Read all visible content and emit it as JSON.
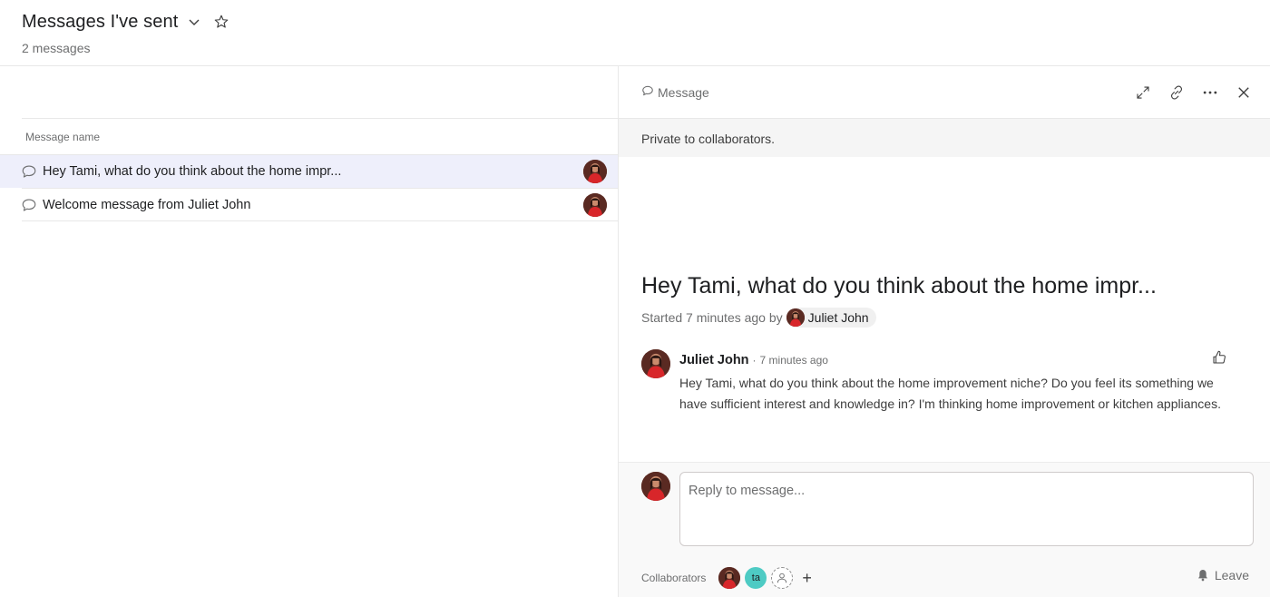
{
  "header": {
    "title": "Messages I've sent",
    "subtitle": "2 messages",
    "chevron_icon": "chevron-down-icon",
    "star_icon": "star-icon"
  },
  "list": {
    "column_header": "Message name",
    "rows": [
      {
        "label": "Hey Tami, what do you think about the home impr...",
        "selected": true
      },
      {
        "label": "Welcome message from Juliet John",
        "selected": false
      }
    ]
  },
  "detail": {
    "type_label": "Message",
    "privacy": "Private to collaborators.",
    "title": "Hey Tami, what do you think about the home impr...",
    "started_prefix": "Started 7 minutes ago by",
    "author": "Juliet John",
    "comment": {
      "author": "Juliet John",
      "separator": "·",
      "time": "7 minutes ago",
      "body": "Hey Tami, what do you think about the home improvement niche? Do you feel its something we have sufficient interest and knowledge in? I'm thinking home improvement or kitchen appliances."
    },
    "reply_placeholder": "Reply to message...",
    "collaborators_label": "Collaborators",
    "collaborator_initials": "ta",
    "plus_label": "+",
    "leave_label": "Leave"
  },
  "colors": {
    "selected_row": "#eeeffb",
    "avatar_teal": "#4ecbc4",
    "privacy_bg": "#f5f5f5"
  }
}
